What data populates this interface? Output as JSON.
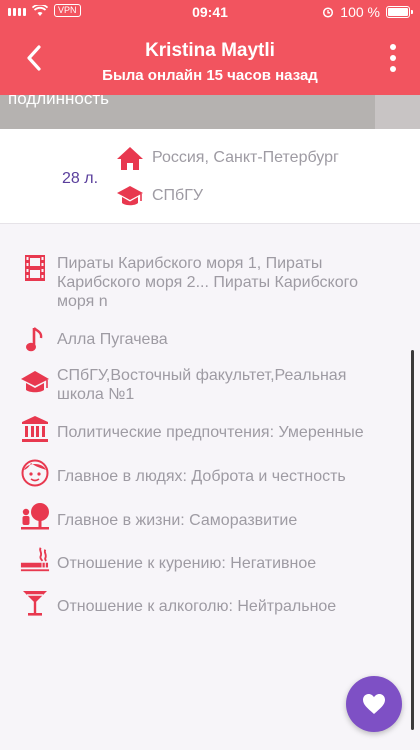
{
  "status_bar": {
    "vpn": "VPN",
    "time": "09:41",
    "battery": "100 %"
  },
  "header": {
    "title": "Kristina Maytli",
    "subtitle": "Была онлайн 15 часов назад"
  },
  "photo": {
    "caption": "подлинность"
  },
  "profile": {
    "age": "28 л.",
    "location": "Россия, Санкт-Петербург",
    "university": "СПбГУ"
  },
  "details": [
    {
      "icon": "film-icon",
      "text": "Пираты Карибского моря 1, Пираты Карибского моря 2... Пираты Карибского моря n"
    },
    {
      "icon": "music-note-icon",
      "text": "Алла Пугачева"
    },
    {
      "icon": "graduation-cap-icon",
      "text": "СПбГУ,Восточный факультет,Реальная школа №1"
    },
    {
      "icon": "government-building-icon",
      "text": "Политические предпочтения: Умеренные"
    },
    {
      "icon": "face-icon",
      "text": "Главное в людях: Доброта и честность"
    },
    {
      "icon": "person-tree-icon",
      "text": "Главное в жизни: Саморазвитие"
    },
    {
      "icon": "cigarette-icon",
      "text": "Отношение к курению: Негативное"
    },
    {
      "icon": "cocktail-glass-icon",
      "text": "Отношение к алкоголю: Нейтральное"
    }
  ],
  "colors": {
    "header": "#f2545f",
    "accent": "#e8384f",
    "age_text": "#5a3f9c",
    "fab": "#7e50c5",
    "muted_text": "#9e9ba3"
  },
  "fab": {
    "icon": "heart-icon"
  }
}
